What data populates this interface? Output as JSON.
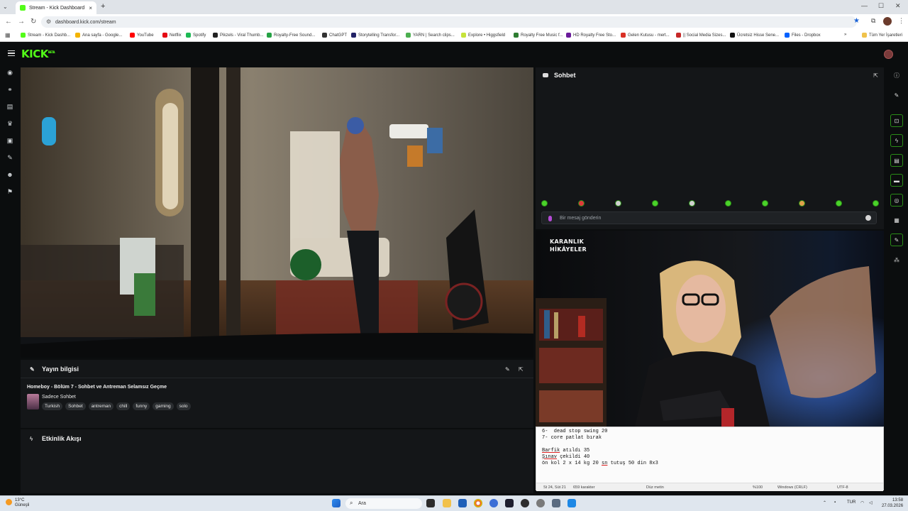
{
  "browser": {
    "tab_title": "Stream - Kick Dashboard",
    "tab_close": "×",
    "new_tab": "+",
    "url": "dashboard.kick.com/stream",
    "bookmarks": [
      {
        "label": "Stream - Kick Dashb...",
        "color": "#53fc18"
      },
      {
        "label": "Ana sayfa - Google...",
        "color": "#f4b400"
      },
      {
        "label": "YouTube",
        "color": "#ff0000"
      },
      {
        "label": "Netflix",
        "color": "#e50914"
      },
      {
        "label": "Spotify",
        "color": "#1db954"
      },
      {
        "label": "Pikzels - Viral Thumb...",
        "color": "#222222"
      },
      {
        "label": "Royalty-Free Sound...",
        "color": "#25a244"
      },
      {
        "label": "ChatGPT",
        "color": "#333333"
      },
      {
        "label": "Storytelling Transfor...",
        "color": "#222266"
      },
      {
        "label": "YARN | Search clips...",
        "color": "#4caf50"
      },
      {
        "label": "Explore • Higgsfield",
        "color": "#c6e33a"
      },
      {
        "label": "Royalty Free Music f...",
        "color": "#2e7d32"
      },
      {
        "label": "HD Royalty Free Sto...",
        "color": "#6a1b9a"
      },
      {
        "label": "Gelen Kutusu - mert...",
        "color": "#d93025"
      },
      {
        "label": "|| Social Media Sizes...",
        "color": "#c62828"
      },
      {
        "label": "Ücretsiz Hisse Sene...",
        "color": "#111111"
      },
      {
        "label": "Files - Dropbox",
        "color": "#0061fe"
      }
    ],
    "all_bookmarks": "Tüm Yer İşaretleri"
  },
  "kick": {
    "logo": "KICK",
    "logo_badge": "BETA"
  },
  "stream_info": {
    "header": "Yayın bilgisi",
    "title": "Homeboy - Bölüm 7 - Sohbet ve Antreman Selamsız Geçme",
    "category": "Sadece Sohbet",
    "tags": [
      "Turkish",
      "Sohbet",
      "antreman",
      "chill",
      "funny",
      "gaming",
      "solo"
    ]
  },
  "activity": {
    "header": "Etkinlik Akışı"
  },
  "chat": {
    "header": "Sohbet",
    "input_placeholder": "Bir mesaj gönderin"
  },
  "side_video": {
    "watermark_line1": "KARANLIK",
    "watermark_line2": "HİKÂYELER"
  },
  "notepad": {
    "line1": "6-  dead stop swing 20",
    "line2": "7- core patlat bırak",
    "line3": "",
    "line4_word": "Barfik",
    "line4_rest": " atıldı 35",
    "line5_word": "Şınav",
    "line5_rest": " çekildi 40",
    "line6_a": "ön kol 2 x 14 kg 20 ",
    "line6_word": "sn",
    "line6_b": " tutuş 50 din 8x3",
    "status_pos": "St 24, Süt 21",
    "status_chars": "659 karakter",
    "status_mode": "Düz metin",
    "status_zoom": "%100",
    "status_eol": "Windows (CRLF)",
    "status_enc": "UTF-8"
  },
  "taskbar": {
    "temp": "13°C",
    "weather": "Güneşli",
    "search": "Ara",
    "lang": "TUR",
    "time": "13:58",
    "date": "27.03.2026"
  }
}
